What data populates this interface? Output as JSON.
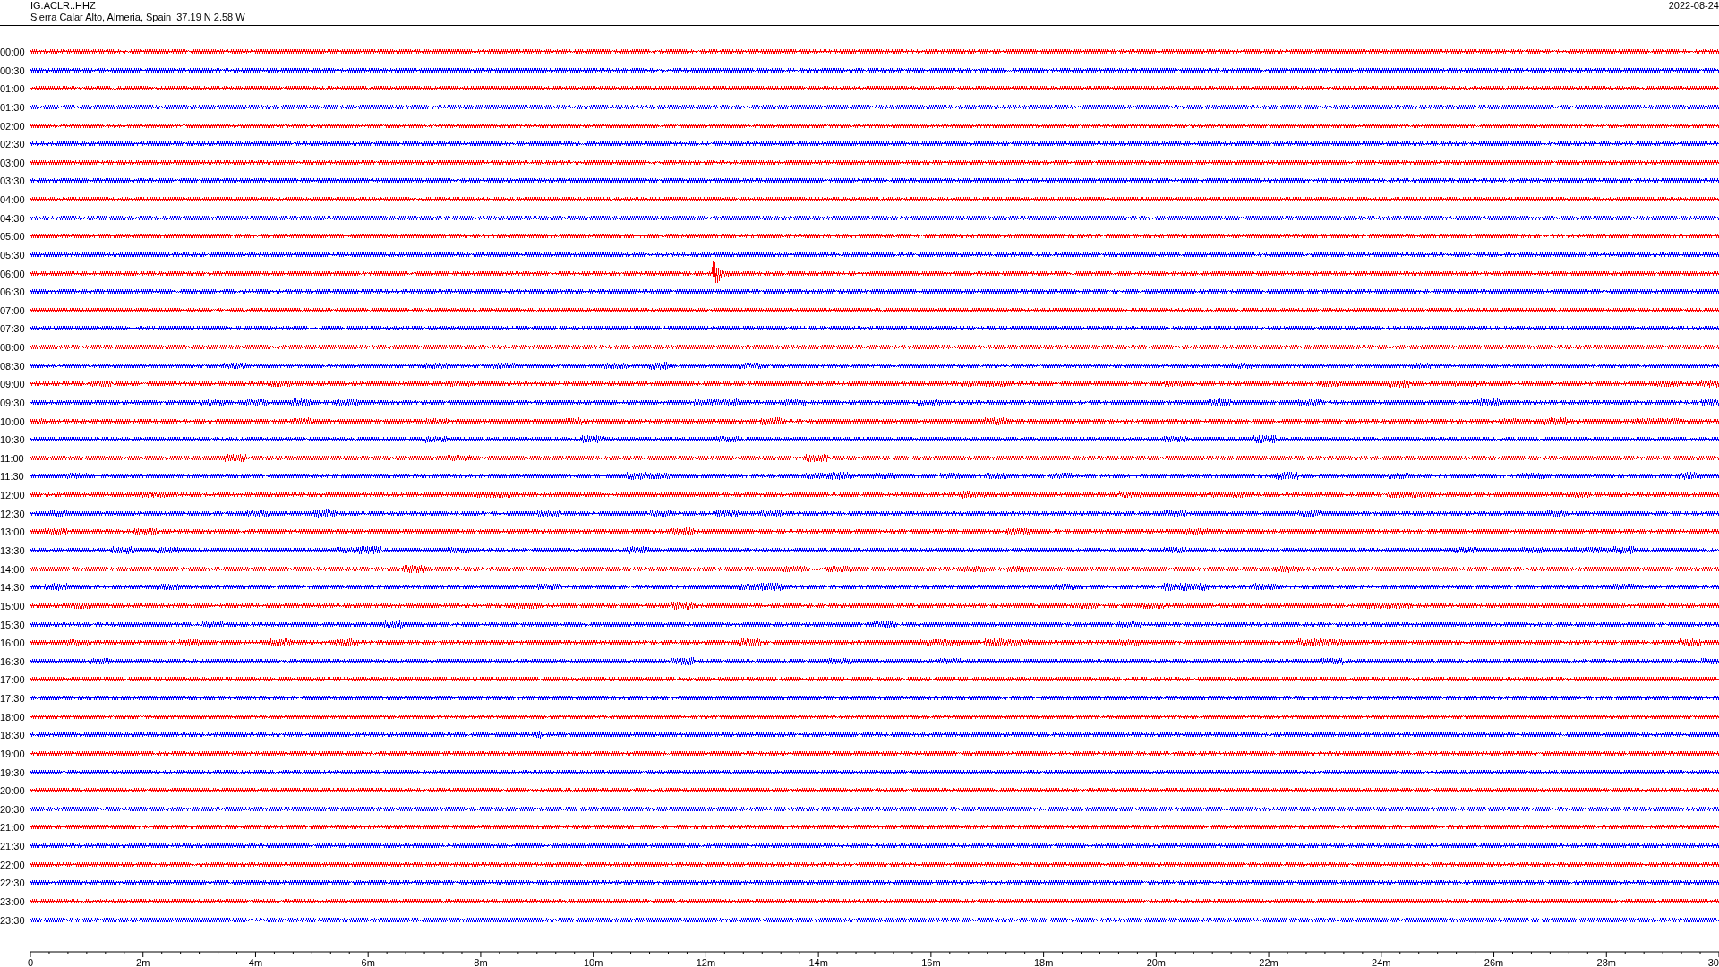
{
  "header": {
    "station": "IG.ACLR..HHZ",
    "location": "Sierra Calar Alto, Almeria, Spain  37.19 N 2.58 W",
    "date": "2022-08-24"
  },
  "rows": [
    {
      "time": "00:00",
      "color": "#ff0000"
    },
    {
      "time": "00:30",
      "color": "#0000ff"
    },
    {
      "time": "01:00",
      "color": "#ff0000"
    },
    {
      "time": "01:30",
      "color": "#0000ff"
    },
    {
      "time": "02:00",
      "color": "#ff0000"
    },
    {
      "time": "02:30",
      "color": "#0000ff"
    },
    {
      "time": "03:00",
      "color": "#ff0000"
    },
    {
      "time": "03:30",
      "color": "#0000ff"
    },
    {
      "time": "04:00",
      "color": "#ff0000"
    },
    {
      "time": "04:30",
      "color": "#0000ff"
    },
    {
      "time": "05:00",
      "color": "#ff0000"
    },
    {
      "time": "05:30",
      "color": "#0000ff"
    },
    {
      "time": "06:00",
      "color": "#ff0000"
    },
    {
      "time": "06:30",
      "color": "#0000ff"
    },
    {
      "time": "07:00",
      "color": "#ff0000"
    },
    {
      "time": "07:30",
      "color": "#0000ff"
    },
    {
      "time": "08:00",
      "color": "#ff0000"
    },
    {
      "time": "08:30",
      "color": "#0000ff"
    },
    {
      "time": "09:00",
      "color": "#ff0000"
    },
    {
      "time": "09:30",
      "color": "#0000ff"
    },
    {
      "time": "10:00",
      "color": "#ff0000"
    },
    {
      "time": "10:30",
      "color": "#0000ff"
    },
    {
      "time": "11:00",
      "color": "#ff0000"
    },
    {
      "time": "11:30",
      "color": "#0000ff"
    },
    {
      "time": "12:00",
      "color": "#ff0000"
    },
    {
      "time": "12:30",
      "color": "#0000ff"
    },
    {
      "time": "13:00",
      "color": "#ff0000"
    },
    {
      "time": "13:30",
      "color": "#0000ff"
    },
    {
      "time": "14:00",
      "color": "#ff0000"
    },
    {
      "time": "14:30",
      "color": "#0000ff"
    },
    {
      "time": "15:00",
      "color": "#ff0000"
    },
    {
      "time": "15:30",
      "color": "#0000ff"
    },
    {
      "time": "16:00",
      "color": "#ff0000"
    },
    {
      "time": "16:30",
      "color": "#0000ff"
    },
    {
      "time": "17:00",
      "color": "#ff0000"
    },
    {
      "time": "17:30",
      "color": "#0000ff"
    },
    {
      "time": "18:00",
      "color": "#ff0000"
    },
    {
      "time": "18:30",
      "color": "#0000ff"
    },
    {
      "time": "19:00",
      "color": "#ff0000"
    },
    {
      "time": "19:30",
      "color": "#0000ff"
    },
    {
      "time": "20:00",
      "color": "#ff0000"
    },
    {
      "time": "20:30",
      "color": "#0000ff"
    },
    {
      "time": "21:00",
      "color": "#ff0000"
    },
    {
      "time": "21:30",
      "color": "#0000ff"
    },
    {
      "time": "22:00",
      "color": "#ff0000"
    },
    {
      "time": "22:30",
      "color": "#0000ff"
    },
    {
      "time": "23:00",
      "color": "#ff0000"
    },
    {
      "time": "23:30",
      "color": "#0000ff"
    }
  ],
  "axis": {
    "labels": [
      "0",
      "2m",
      "4m",
      "6m",
      "8m",
      "10m",
      "12m",
      "14m",
      "16m",
      "18m",
      "20m",
      "22m",
      "24m",
      "26m",
      "28m",
      "30"
    ]
  }
}
